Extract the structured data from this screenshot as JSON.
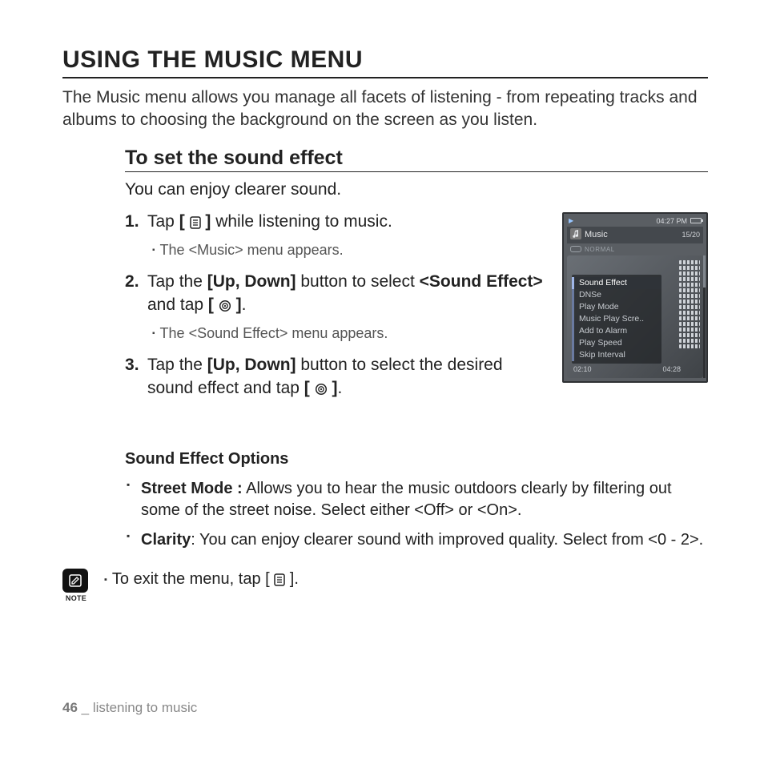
{
  "title": "USING THE MUSIC MENU",
  "intro": "The Music menu allows you manage all facets of listening - from repeating tracks and albums to choosing the background on the screen as you listen.",
  "section_heading": "To set the sound effect",
  "lead": "You can enjoy clearer sound.",
  "steps": {
    "s1_a": "Tap ",
    "s1_b": " while listening to music.",
    "s1_sub": "The <Music> menu appears.",
    "s2_a": "Tap the ",
    "s2_updown": "[Up, Down]",
    "s2_b": " button to select ",
    "s2_sound": "<Sound Effect>",
    "s2_c": " and tap ",
    "s2_d": ".",
    "s2_sub": "The <Sound Effect> menu appears.",
    "s3_a": "Tap the ",
    "s3_updown": "[Up, Down]",
    "s3_b": " button to select the desired sound effect and tap ",
    "s3_c": "."
  },
  "options": {
    "heading": "Sound Effect Options",
    "street_label": "Street Mode :",
    "street_text": " Allows you to hear the music outdoors clearly by filtering out some of the street noise. Select either <Off> or <On>.",
    "clarity_label": "Clarity",
    "clarity_text": ": You can enjoy clearer sound with improved quality. Select from <0 - 2>."
  },
  "note": {
    "label": "NOTE",
    "text_a": "To exit the menu, tap [ ",
    "text_b": " ]."
  },
  "footer": {
    "page": "46",
    "sep": " _ ",
    "chapter": "listening to music"
  },
  "device": {
    "clock": "04:27 PM",
    "title": "Music",
    "count": "15/20",
    "mode": "NORMAL",
    "menu": [
      "Sound Effect",
      "DNSe",
      "Play Mode",
      "Music Play Scre..",
      "Add to Alarm",
      "Play Speed",
      "Skip Interval"
    ],
    "t_left": "02:10",
    "t_right": "04:28"
  }
}
